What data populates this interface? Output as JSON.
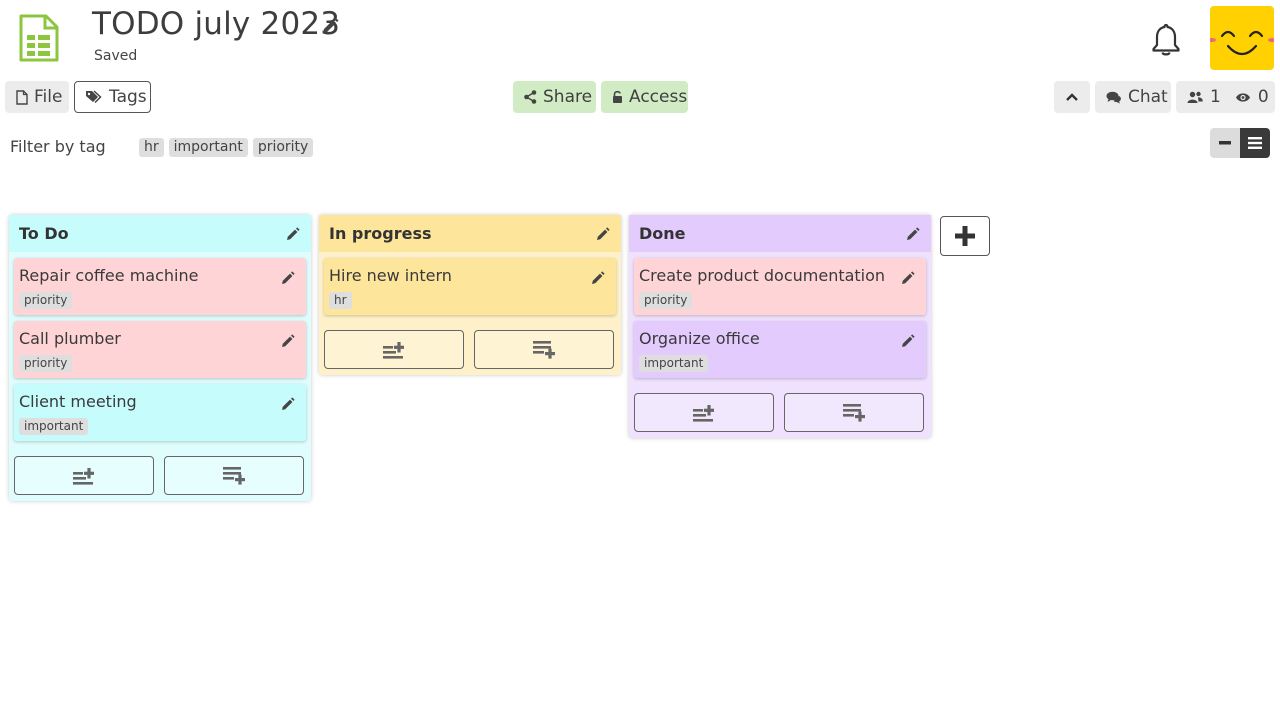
{
  "header": {
    "title": "TODO july 2023",
    "status": "Saved",
    "doc_icon": "spreadsheet-icon",
    "colors": {
      "doc_icon": "#8cc63f",
      "avatar_bg": "#ffd100"
    }
  },
  "toolbar": {
    "file_label": "File",
    "tags_label": "Tags",
    "share_label": "Share",
    "access_label": "Access",
    "chat_label": "Chat",
    "users_count": "1",
    "viewers_count": "0"
  },
  "filter": {
    "label": "Filter by tag",
    "tags": [
      "hr",
      "important",
      "priority"
    ]
  },
  "board": {
    "columns": [
      {
        "title": "To Do",
        "color": "#c7fcfc",
        "items": [
          {
            "title": "Repair coffee machine",
            "tag": "priority",
            "color": "#ffd4d6"
          },
          {
            "title": "Call plumber",
            "tag": "priority",
            "color": "#ffd4d6"
          },
          {
            "title": "Client meeting",
            "tag": "important",
            "color": "#c7fcfc"
          }
        ]
      },
      {
        "title": "In progress",
        "color": "#fde59c",
        "items": [
          {
            "title": "Hire new intern",
            "tag": "hr",
            "color": "#fde59c"
          }
        ]
      },
      {
        "title": "Done",
        "color": "#e3cbfd",
        "items": [
          {
            "title": "Create product documentation",
            "tag": "priority",
            "color": "#ffd4d6"
          },
          {
            "title": "Organize office",
            "tag": "important",
            "color": "#e3cbfd"
          }
        ]
      }
    ]
  }
}
